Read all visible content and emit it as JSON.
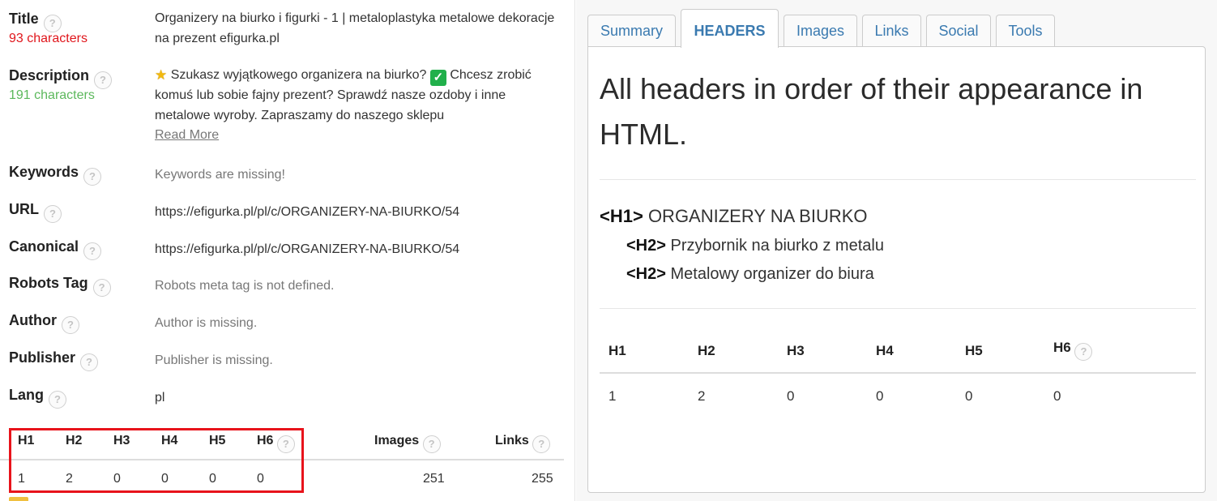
{
  "meta": {
    "title": {
      "label": "Title",
      "count": "93 characters",
      "value": "Organizery na biurko i figurki - 1 | metaloplastyka metalowe dekoracje na prezent efigurka.pl"
    },
    "description": {
      "label": "Description",
      "count": "191 characters",
      "value_part1": " Szukasz wyjątkowego organizera na biurko? ",
      "value_part2": " Chcesz zrobić komuś lub sobie fajny prezent? Sprawdź nasze ozdoby i inne metalowe wyroby. Zapraszamy do naszego sklepu",
      "read_more": "Read More"
    },
    "keywords": {
      "label": "Keywords",
      "value": "Keywords are missing!"
    },
    "url": {
      "label": "URL",
      "value": "https://efigurka.pl/pl/c/ORGANIZERY-NA-BIURKO/54"
    },
    "canonical": {
      "label": "Canonical",
      "value": "https://efigurka.pl/pl/c/ORGANIZERY-NA-BIURKO/54"
    },
    "robots": {
      "label": "Robots Tag",
      "value": "Robots meta tag is not defined."
    },
    "author": {
      "label": "Author",
      "value": "Author is missing."
    },
    "publisher": {
      "label": "Publisher",
      "value": "Publisher is missing."
    },
    "lang": {
      "label": "Lang",
      "value": "pl"
    }
  },
  "help_glyph": "?",
  "icons": {
    "help": "help-circle-icon",
    "star": "star-icon",
    "check": "check-box-icon"
  },
  "star_glyph": "★",
  "check_glyph": "✓",
  "left_stats": {
    "headers": [
      "H1",
      "H2",
      "H3",
      "H4",
      "H5",
      "H6"
    ],
    "values": [
      "1",
      "2",
      "0",
      "0",
      "0",
      "0"
    ],
    "images_label": "Images",
    "images_value": "251",
    "links_label": "Links",
    "links_value": "255"
  },
  "tabs": [
    "Summary",
    "HEADERS",
    "Images",
    "Links",
    "Social",
    "Tools"
  ],
  "active_tab": "HEADERS",
  "headers_panel": {
    "title": "All headers in order of their appearance in HTML.",
    "entries": [
      {
        "tag": "<H1>",
        "text": " ORGANIZERY NA BIURKO"
      },
      {
        "tag": "<H2>",
        "text": " Przybornik na biurko z metalu"
      },
      {
        "tag": "<H2>",
        "text": " Metalowy organizer do biura"
      }
    ],
    "stats_headers": [
      "H1",
      "H2",
      "H3",
      "H4",
      "H5",
      "H6"
    ],
    "stats_values": [
      "1",
      "2",
      "0",
      "0",
      "0",
      "0"
    ]
  },
  "colors": {
    "accent": "#3a7ab0",
    "red": "#e0161c",
    "green": "#5cb85c",
    "highlight_box": "#e8131b"
  }
}
